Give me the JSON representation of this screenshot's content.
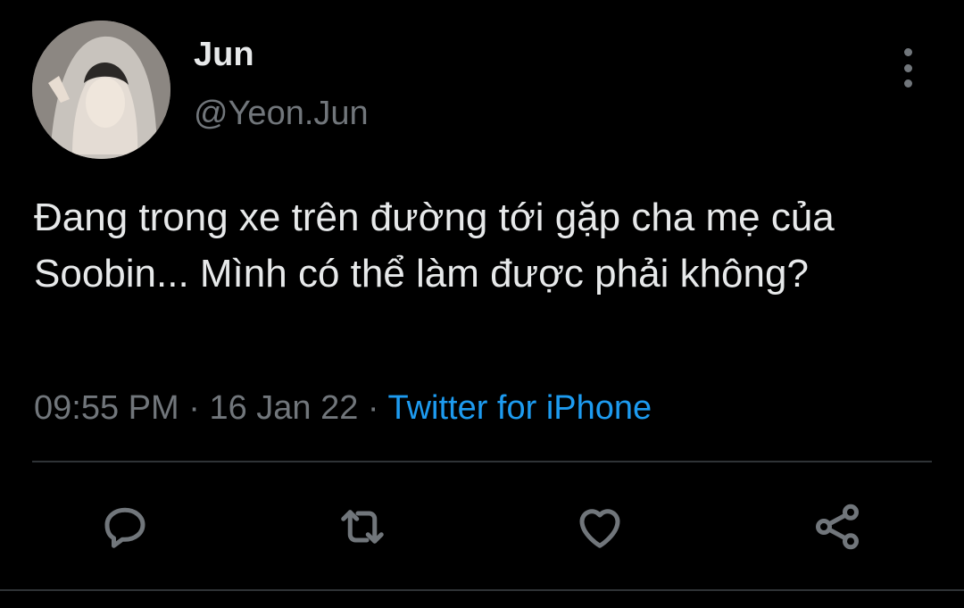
{
  "tweet": {
    "author": {
      "name": "Jun",
      "handle": "@Yeon.Jun",
      "avatar_icon": "avatar-photo"
    },
    "text": "Đang trong xe trên đường tới gặp cha mẹ của Soobin... Mình có thể làm được phải không?",
    "time": "09:55 PM",
    "separator": "·",
    "date": "16 Jan 22",
    "source": "Twitter for iPhone"
  },
  "actions": [
    {
      "icon": "reply-icon"
    },
    {
      "icon": "retweet-icon"
    },
    {
      "icon": "like-icon"
    },
    {
      "icon": "share-icon"
    }
  ],
  "colors": {
    "background": "#000000",
    "text_primary": "#e7e9ea",
    "text_secondary": "#71767b",
    "link": "#1d9bf0",
    "divider": "#2f3336"
  }
}
